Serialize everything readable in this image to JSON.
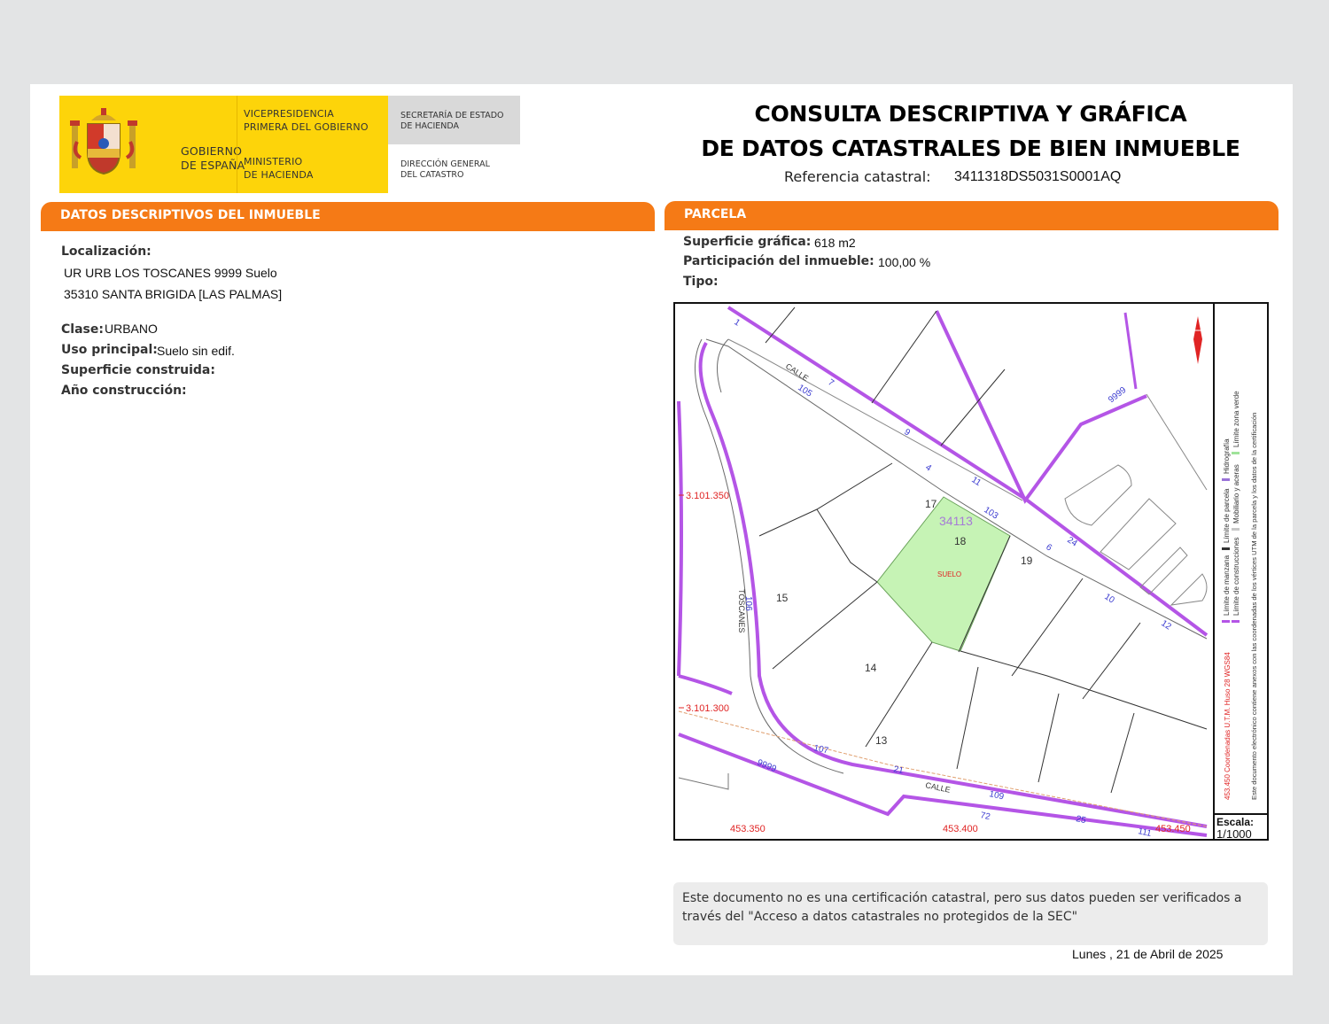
{
  "header": {
    "gobierno": [
      "GOBIERNO",
      "DE ESPAÑA"
    ],
    "vicepresidencia": [
      "VICEPRESIDENCIA",
      "PRIMERA DEL GOBIERNO"
    ],
    "ministerio": [
      "MINISTERIO",
      "DE HACIENDA"
    ],
    "secretaria": [
      "SECRETARÍA DE ESTADO",
      "DE HACIENDA"
    ],
    "direccion": [
      "DIRECCIÓN GENERAL",
      "DEL CATASTRO"
    ],
    "title_line1": "CONSULTA DESCRIPTIVA Y GRÁFICA",
    "title_line2": "DE DATOS CATASTRALES DE BIEN INMUEBLE",
    "ref_label": "Referencia catastral:",
    "ref_value": "3411318DS5031S0001AQ"
  },
  "descriptivos": {
    "section_title": "DATOS DESCRIPTIVOS DEL INMUEBLE",
    "localizacion_label": "Localización:",
    "localizacion_line1": "UR URB LOS TOSCANES 9999 Suelo",
    "localizacion_line2": "35310 SANTA BRIGIDA [LAS PALMAS]",
    "clase_label": "Clase:",
    "clase_value": "URBANO",
    "uso_label": "Uso principal:",
    "uso_value": "Suelo sin edif.",
    "superficie_label": "Superficie construida:",
    "ano_label": "Año construcción:"
  },
  "parcela": {
    "section_title": "PARCELA",
    "superficie_label": "Superficie gráfica:",
    "superficie_value": "618 m2",
    "participacion_label": "Participación del inmueble:",
    "participacion_value": "100,00 %",
    "tipo_label": "Tipo:"
  },
  "map": {
    "parcel_ref": "34113",
    "parcel_label": "SUELO",
    "parcel_numbers": [
      "17",
      "18",
      "19",
      "15",
      "14",
      "13"
    ],
    "street_numbers": [
      "1",
      "7",
      "105",
      "9",
      "4",
      "11",
      "103",
      "6",
      "24",
      "10",
      "12",
      "106",
      "107",
      "9999",
      "9999",
      "21",
      "109",
      "72",
      "25",
      "111"
    ],
    "street_names": [
      "CALLE",
      "TOSCANES",
      "CALLE"
    ],
    "coords": [
      "3.101.350",
      "3.101.300",
      "453.350",
      "453.400",
      "453.450"
    ],
    "legend": [
      "Límite de manzana",
      "Límite de construcciones",
      "Límite de parcela",
      "Mobiliario y aceras",
      "Hidrografía",
      "Límite zona verde"
    ],
    "utm_note": "453.450 Coordenadas U.T.M. Huso 28 WGS84",
    "doc_note": "Este documento electrónico contiene anexos con las coordenadas de los vértices UTM de la parcela y los datos de la certificación",
    "scale_label": "Escala:",
    "scale_value": "1/1000",
    "colors": {
      "parcel_fill": "#c6f3b5",
      "street_limit": "#b455e6",
      "coords": "#e02424",
      "numbers": "#3b3bd0"
    }
  },
  "notice": {
    "text_line1": "Este documento no es una certificación catastral, pero sus datos pueden ser verificados a",
    "text_line2": "través del \"Acceso a datos catastrales no protegidos de la SEC\""
  },
  "date": "Lunes , 21 de Abril de 2025"
}
